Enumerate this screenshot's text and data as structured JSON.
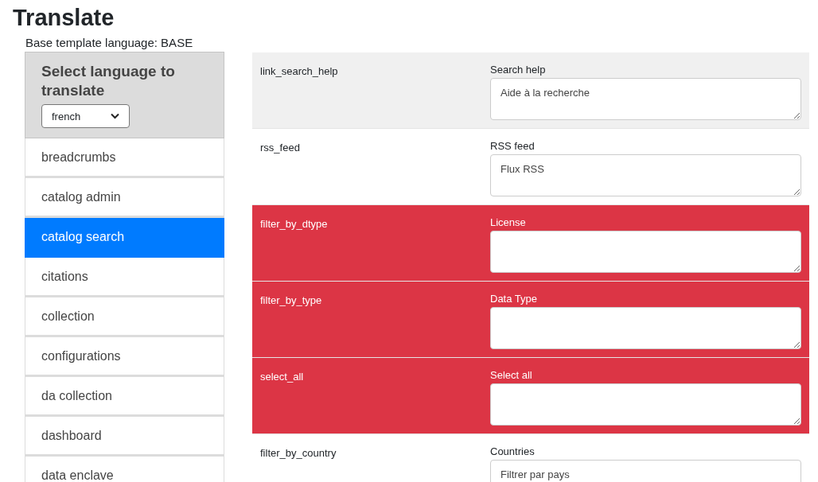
{
  "title": "Translate",
  "base_language": "Base template language: BASE",
  "language_panel": {
    "heading": "Select language to translate",
    "selected_language": "french"
  },
  "sidebar": {
    "items": [
      {
        "label": "breadcrumbs",
        "selected": false
      },
      {
        "label": "catalog admin",
        "selected": false
      },
      {
        "label": "catalog search",
        "selected": true
      },
      {
        "label": "citations",
        "selected": false
      },
      {
        "label": "collection",
        "selected": false
      },
      {
        "label": "configurations",
        "selected": false
      },
      {
        "label": "da collection",
        "selected": false
      },
      {
        "label": "dashboard",
        "selected": false
      },
      {
        "label": "data enclave",
        "selected": false
      }
    ]
  },
  "rows": [
    {
      "key": "link_search_help",
      "label": "Search help",
      "value": "Aide à la recherche",
      "kind": "highlighted"
    },
    {
      "key": "rss_feed",
      "label": "RSS feed",
      "value": "Flux RSS",
      "kind": "normal"
    },
    {
      "key": "filter_by_dtype",
      "label": "License",
      "kind": "missing"
    },
    {
      "key": "filter_by_type",
      "label": "Data Type",
      "kind": "missing"
    },
    {
      "key": "select_all",
      "label": "Select all",
      "kind": "missing"
    },
    {
      "key": "filter_by_country",
      "label": "Countries",
      "value": "Filtrer par pays",
      "kind": "normal"
    }
  ]
}
